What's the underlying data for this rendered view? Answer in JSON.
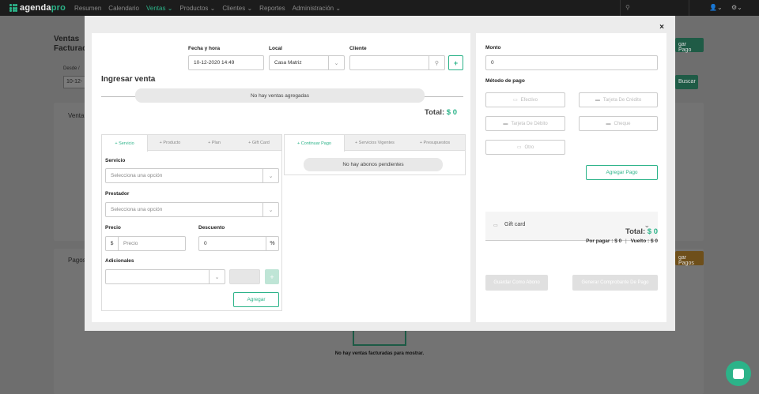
{
  "nav": {
    "logo_main": "agenda",
    "logo_pro": "pro",
    "items": [
      "Resumen",
      "Calendario",
      "Ventas ⌄",
      "Productos ⌄",
      "Clientes ⌄",
      "Reportes",
      "Administración ⌄"
    ],
    "active_index": 2,
    "search_icon": "search-icon"
  },
  "background": {
    "title_line1": "Ventas",
    "title_line2": "Facturad",
    "desde_label": "Desde /",
    "desde_value": "10-12-",
    "ventas_label": "Venta",
    "pagos_label": "Pagos",
    "agregar_pago_btn": "gar Pago",
    "buscar_btn": "Buscar",
    "agregar_pagos_btn": "gar Pagos",
    "empty_text": "No hay ventas facturadas para mostrar."
  },
  "modal": {
    "close": "×",
    "title": "Ingresar venta",
    "fecha_label": "Fecha y hora",
    "fecha_value": "10-12-2020 14:49",
    "local_label": "Local",
    "local_value": "Casa Matriz",
    "cliente_label": "Cliente",
    "cliente_value": "",
    "no_ventas": "No hay ventas agregadas",
    "total_label": "Total:",
    "total_value": "$ 0",
    "item_tabs": [
      "+ Servicio",
      "+ Producto",
      "+ Plan",
      "+ Gift Card"
    ],
    "servicio_label": "Servicio",
    "servicio_placeholder": "Selecciona una opción",
    "prestador_label": "Prestador",
    "prestador_placeholder": "Selecciona una opción",
    "precio_label": "Precio",
    "precio_prefix": "$",
    "precio_placeholder": "Precio",
    "descuento_label": "Descuento",
    "descuento_value": "0",
    "descuento_suffix": "%",
    "adicionales_label": "Adicionales",
    "agregar_btn": "Agregar",
    "pay_tabs": [
      "+ Continuar Pago",
      "+ Servicios Vigentes",
      "+ Presupuestos"
    ],
    "no_abonos": "No hay abonos pendientes"
  },
  "payment": {
    "monto_label": "Monto",
    "monto_value": "0",
    "metodo_label": "Método de pago",
    "methods": [
      {
        "label": "Efectivo",
        "icon": "cash-icon",
        "glyph": "▭"
      },
      {
        "label": "Tarjeta De Crédito",
        "icon": "credit-card-icon",
        "glyph": "▬"
      },
      {
        "label": "Tarjeta De Débito",
        "icon": "debit-card-icon",
        "glyph": "▬"
      },
      {
        "label": "Cheque",
        "icon": "cheque-icon",
        "glyph": "▬"
      },
      {
        "label": "Otro",
        "icon": "other-icon",
        "glyph": "▭"
      }
    ],
    "agregar_pago": "Agregar Pago",
    "gift_card": "Gift card",
    "total_label": "Total:",
    "total_value": "$ 0",
    "por_pagar": "Por pagar : $ 0",
    "separator": "|",
    "vuelto": "Vuelto : $ 0",
    "guardar_abono": "Guardar Como Abono",
    "generar_comprobante": "Generar Comprobante De Pago"
  },
  "colors": {
    "accent": "#2cb389",
    "nav_bg": "#1c1c1c",
    "overlay_bg": "#6e6e6e"
  }
}
